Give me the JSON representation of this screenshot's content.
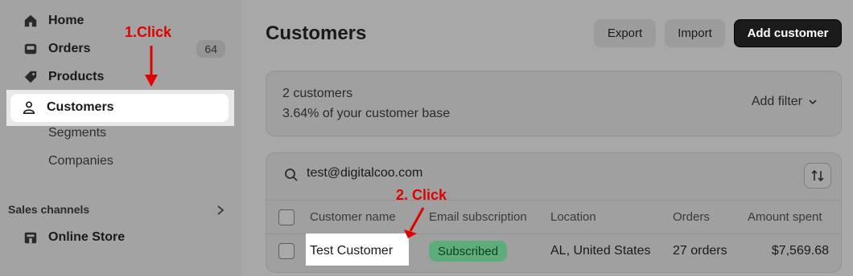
{
  "sidebar": {
    "items": [
      {
        "label": "Home",
        "icon": "home-icon"
      },
      {
        "label": "Orders",
        "icon": "inbox-icon",
        "badge": "64"
      },
      {
        "label": "Products",
        "icon": "tag-icon"
      },
      {
        "label": "Customers",
        "icon": "person-icon"
      },
      {
        "label": "Segments"
      },
      {
        "label": "Companies"
      }
    ],
    "section_title": "Sales channels",
    "channels": [
      {
        "label": "Online Store",
        "icon": "store-icon"
      }
    ]
  },
  "annotations": {
    "step1": "1.Click",
    "step2": "2. Click",
    "color": "#e00000"
  },
  "header": {
    "title": "Customers",
    "export_label": "Export",
    "import_label": "Import",
    "add_label": "Add customer"
  },
  "summary": {
    "count": "2 customers",
    "percent": "3.64%",
    "percent_suffix": " of your customer base",
    "add_filter": "Add filter"
  },
  "search": {
    "value": "test@digitalcoo.com"
  },
  "table": {
    "columns": [
      "Customer name",
      "Email subscription",
      "Location",
      "Orders",
      "Amount spent"
    ],
    "rows": [
      {
        "name": "Test Customer",
        "subscription": "Subscribed",
        "location": "AL, United States",
        "orders": "27 orders",
        "amount": "$7,569.68"
      }
    ]
  },
  "colors": {
    "accent_badge": "#5cad7a",
    "primary_button": "#1b1b1b"
  }
}
